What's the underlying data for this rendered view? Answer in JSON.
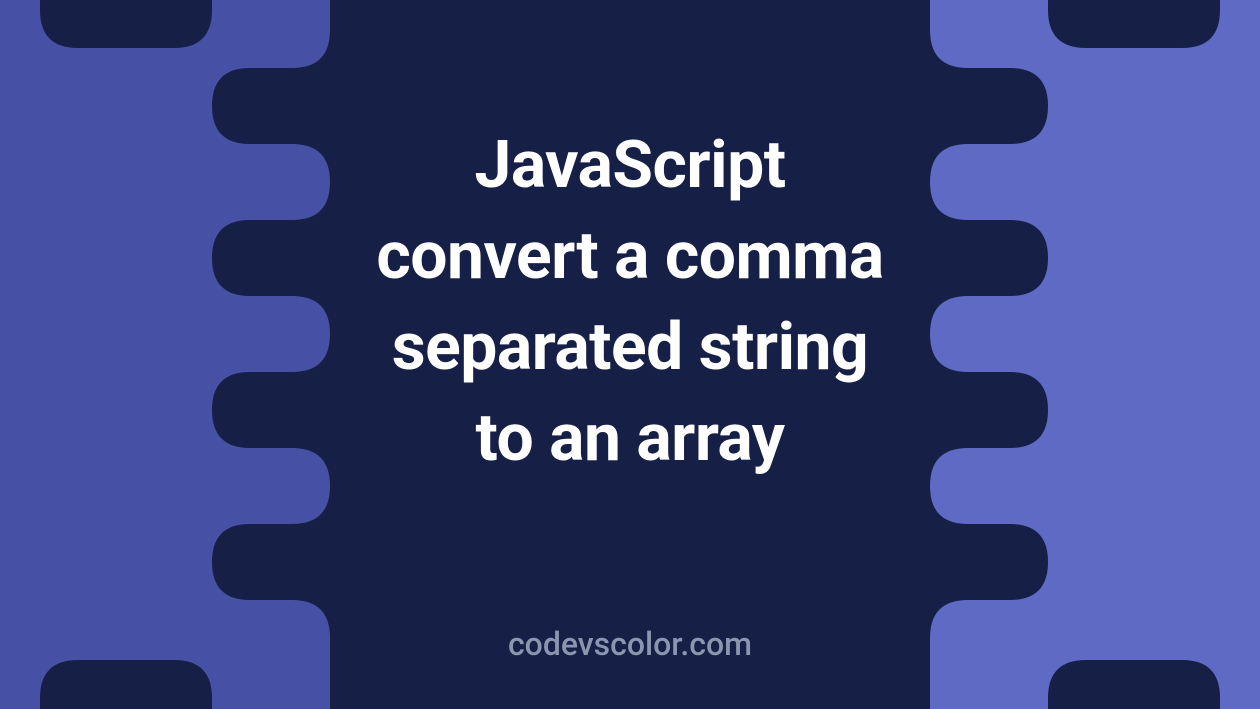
{
  "headline": {
    "line1": "JavaScript",
    "line2": "convert a comma",
    "line3": "separated string",
    "line4": "to an array"
  },
  "attribution": "codevscolor.com",
  "colors": {
    "blob": "#161f46",
    "bg_left": "#4651a5",
    "bg_right": "#5e6ac4",
    "text": "#fefefe",
    "attribution": "#8c95b0"
  }
}
